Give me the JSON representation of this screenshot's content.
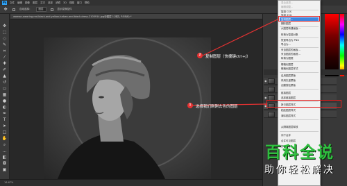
{
  "app": {
    "logo": "Ps"
  },
  "menubar": {
    "items": [
      "文件",
      "编辑",
      "图像",
      "图层",
      "文字",
      "选择",
      "滤镜",
      "3D",
      "视图",
      "窗口",
      "帮助"
    ]
  },
  "options": {
    "auto_select_label": "自动选择：",
    "auto_select_value": "图层",
    "show_transform_label": "显示变换控件"
  },
  "document": {
    "tab_title": "woman-wearing-red-black-and-yellow-turban-and-black-dress-2105914.jpg@图层 1 拷贝, RGB/8) *"
  },
  "status": {
    "zoom": "16.67%"
  },
  "context_menu": {
    "items": [
      "混合选项...",
      "编辑调整...",
      "复制 CSS",
      "复制 SVG",
      "复制图层...",
      "删除图层",
      "从图层新建画板...",
      "转换为智能对象",
      "快速导出为 PNG",
      "导出为...",
      "来自图层的画板...",
      "来自图层的画框...",
      "转换为图框",
      "栅格化图层",
      "栅格化图层样式",
      "启用图层蒙版",
      "停用矢量蒙版",
      "创建剪贴蒙版",
      "链接图层",
      "选择链接图层",
      "拷贝图层样式",
      "粘贴图层样式",
      "清除图层样式",
      "从隔离图层释放",
      "向下合并",
      "合并可见图层",
      "拼合图像"
    ],
    "highlighted_index": 4
  },
  "annotations": [
    {
      "badge": "2",
      "text": "复制图层（快捷键ctrl+J）"
    },
    {
      "badge": "1",
      "text": "选择我们刚刚去色的图层"
    }
  ],
  "watermark": {
    "title": "百科全说",
    "subtitle": "助你轻松解决"
  },
  "colors": {
    "accent": "#3c86e0",
    "annotation_red": "#e53232",
    "watermark_green": "#2fbf3f"
  }
}
